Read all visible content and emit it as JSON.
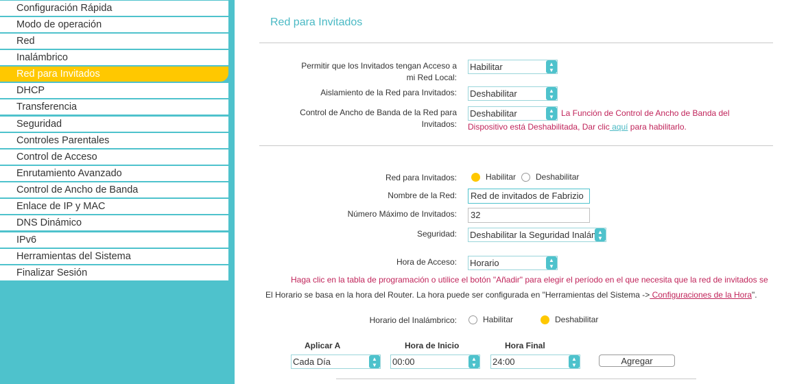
{
  "sidebar": {
    "items": [
      {
        "label": "Configuración Rápida"
      },
      {
        "label": "Modo de operación"
      },
      {
        "label": "Red"
      },
      {
        "label": "Inalámbrico"
      },
      {
        "label": "Red para Invitados",
        "active": true
      },
      {
        "label": "DHCP"
      },
      {
        "label": "Transferencia"
      },
      {
        "label": "Seguridad"
      },
      {
        "label": "Controles Parentales"
      },
      {
        "label": "Control de Acceso"
      },
      {
        "label": "Enrutamiento Avanzado"
      },
      {
        "label": "Control de Ancho de Banda"
      },
      {
        "label": "Enlace de IP y MAC"
      },
      {
        "label": "DNS Dinámico"
      },
      {
        "label": "IPv6"
      },
      {
        "label": "Herramientas del Sistema"
      },
      {
        "label": "Finalizar Sesión"
      }
    ]
  },
  "main": {
    "title": "Red para Invitados",
    "local_access": {
      "label_1": "Permitir que los Invitados tengan Acceso a",
      "label_2": "mi Red Local:",
      "value": "Habilitar"
    },
    "isolation": {
      "label": "Aislamiento de la Red para Invitados:",
      "value": "Deshabilitar"
    },
    "bandwidth": {
      "label_1": "Control de Ancho de Banda de la Red para",
      "label_2": "Invitados:",
      "value": "Deshabilitar",
      "notice_1": "La Función de Control de Ancho de Banda del",
      "notice_2a": "Dispositivo está Deshabilitada, Dar clic",
      "notice_link": " aquí",
      "notice_2b": " para habilitarlo."
    },
    "guest_network": {
      "label": "Red para Invitados:",
      "enable": "Habilitar",
      "disable": "Deshabilitar"
    },
    "network_name": {
      "label": "Nombre de la Red:",
      "value": "Red de invitados de Fabrizio"
    },
    "max_guests": {
      "label": "Número Máximo de Invitados:",
      "value": "32"
    },
    "security": {
      "label": "Seguridad:",
      "value": "Deshabilitar la Seguridad Inalámbrica"
    },
    "access_time": {
      "label": "Hora de Acceso:",
      "value": "Horario"
    },
    "schedule_notice": "Haga clic en la tabla de programación o utilice el botón \"Añadir\" para elegir el período en el que necesita que la red de invitados se",
    "schedule_info": "El Horario se basa en la hora del Router. La hora puede ser configurada en \"Herramientas del Sistema ->",
    "schedule_info_link": " Configuraciones de la Hora",
    "schedule_info_end": "\".",
    "wireless_schedule": {
      "label": "Horario del Inalámbrico:",
      "enable": "Habilitar",
      "disable": "Deshabilitar"
    },
    "table": {
      "apply_head": "Aplicar A",
      "start_head": "Hora de Inicio",
      "end_head": "Hora Final",
      "apply_value": "Cada Día",
      "start_value": "00:00",
      "end_value": "24:00",
      "add_button": "Agregar"
    }
  },
  "colors": {
    "accent": "#4ec2cc",
    "highlight": "#ffc800",
    "notice": "#c0245a"
  }
}
